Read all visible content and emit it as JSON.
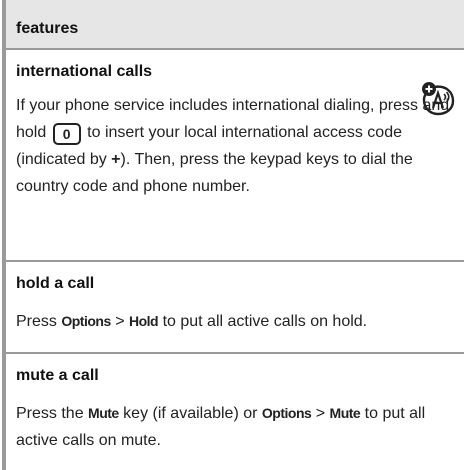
{
  "header": {
    "title": "features"
  },
  "sections": [
    {
      "title": "international calls",
      "icon": "international-calls-icon",
      "text_a": "If your phone service includes international dialing, press and hold",
      "key": "0",
      "text_b": "to insert your local international access code (indicated by",
      "plus": "+",
      "text_c": "). Then, press the keypad keys to dial the country code and phone number."
    },
    {
      "title": "hold a call",
      "t1": "Press",
      "k1": "Options",
      "sep": ">",
      "k2": "Hold",
      "t2": "to put all active calls on hold."
    },
    {
      "title": "mute a call",
      "t1": "Press the",
      "k1": "Mute",
      "t2": "key (if available) or",
      "k2": "Options",
      "sep": ">",
      "k3": "Mute",
      "t3": "to put all active calls on mute."
    }
  ]
}
